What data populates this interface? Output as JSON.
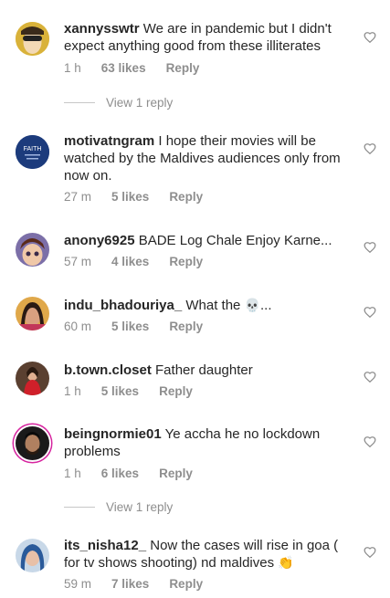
{
  "comments": [
    {
      "username": "xannysswtr",
      "text": "We are in pandemic but I didn't expect anything good from these illiterates",
      "time": "1 h",
      "likes": "63 likes",
      "reply": "Reply"
    },
    {
      "username": "motivatngram",
      "text": "I hope their movies will be watched by the Maldives audiences only from now on.",
      "time": "27 m",
      "likes": "5 likes",
      "reply": "Reply",
      "avatar_text": "FAITH"
    },
    {
      "username": "anony6925",
      "text": "BADE Log Chale Enjoy Karne...",
      "time": "57 m",
      "likes": "4 likes",
      "reply": "Reply"
    },
    {
      "username": "indu_bhadouriya_",
      "text": "What the",
      "emoji": "💀",
      "text_after": "...",
      "time": "60 m",
      "likes": "5 likes",
      "reply": "Reply"
    },
    {
      "username": "b.town.closet",
      "text": "Father daughter",
      "time": "1 h",
      "likes": "5 likes",
      "reply": "Reply"
    },
    {
      "username": "beingnormie01",
      "text": "Ye accha he no lockdown problems",
      "time": "1 h",
      "likes": "6 likes",
      "reply": "Reply"
    },
    {
      "username": "its_nisha12_",
      "text": "Now the cases will rise in goa ( for tv shows shooting) nd maldives",
      "emoji": "👏",
      "time": "59 m",
      "likes": "7 likes",
      "reply": "Reply"
    }
  ],
  "view_replies": [
    "View 1 reply",
    "View 1 reply"
  ],
  "icons": {
    "like": "heart-outline-icon"
  },
  "colors": {
    "text": "#262626",
    "muted": "#8e8e8e",
    "story_ring": "#d6249f"
  }
}
